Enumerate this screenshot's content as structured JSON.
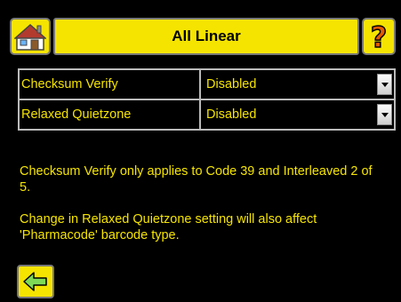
{
  "header": {
    "title": "All Linear",
    "home_icon": "home-icon",
    "help_icon": "help-icon"
  },
  "settings": [
    {
      "label": "Checksum Verify",
      "value": "Disabled"
    },
    {
      "label": "Relaxed Quietzone",
      "value": "Disabled"
    }
  ],
  "info": {
    "line1": "Checksum Verify only applies to Code 39 and Interleaved 2 of 5.",
    "line2": "Change in Relaxed Quietzone setting will also affect 'Pharmacode' barcode type."
  },
  "footer": {
    "back_icon": "back-arrow-icon"
  },
  "colors": {
    "accent": "#f5e400",
    "background": "#000000",
    "border": "#bbbbbb"
  }
}
